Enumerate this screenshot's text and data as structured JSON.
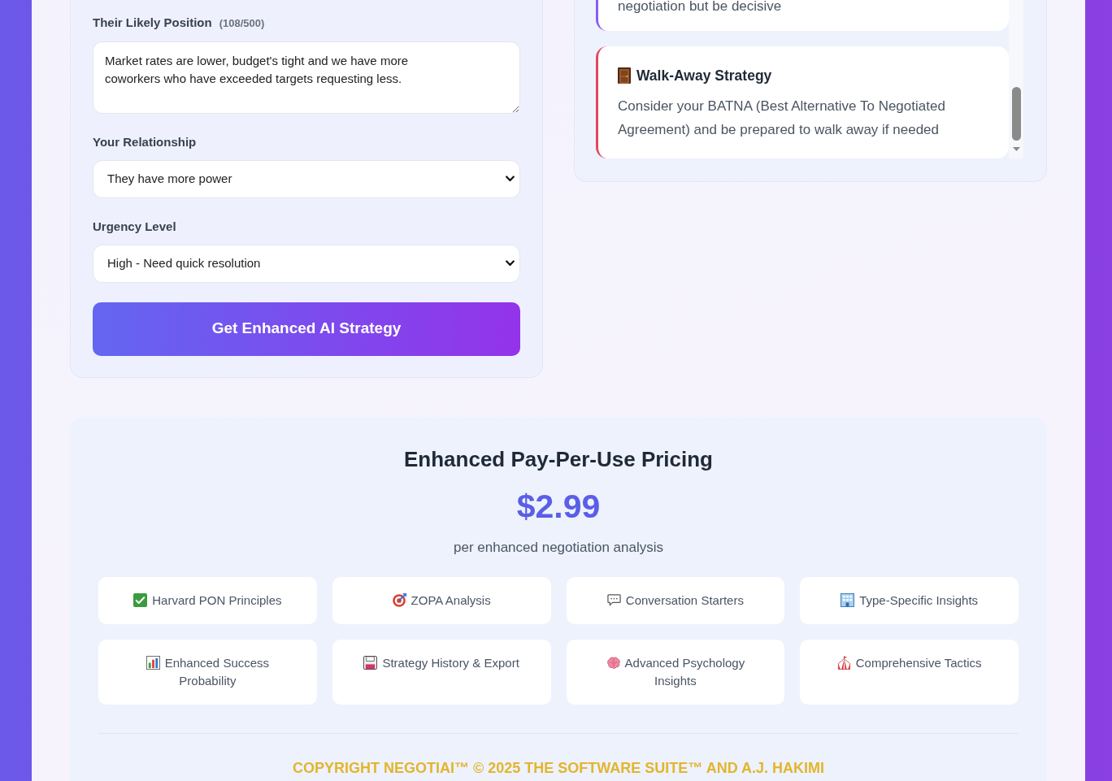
{
  "form": {
    "fields": [
      {
        "kind": "textarea",
        "label": "Their Likely Position",
        "counter": "(108/500)",
        "value": "Market rates are lower, budget's tight and we have more coworkers who have exceeded targets requesting less."
      },
      {
        "kind": "select",
        "label": "Your Relationship",
        "value": "They have more power"
      },
      {
        "kind": "select",
        "label": "Urgency Level",
        "value": "High - Need quick resolution"
      }
    ],
    "submit_button": "Get Enhanced AI Strategy"
  },
  "strategies": [
    {
      "text": "negotiation but be decisive",
      "color": "#8b5cf6"
    },
    {
      "title": "Walk-Away Strategy",
      "text": "Consider your BATNA (Best Alternative To Negotiated Agreement) and be prepared to walk away if needed",
      "color": "#e0485f"
    }
  ],
  "pricing": {
    "title": "Enhanced Pay-Per-Use Pricing",
    "price": "$2.99",
    "price_note": "per enhanced negotiation analysis",
    "features": [
      "Harvard PON Principles",
      "ZOPA Analysis",
      "Conversation Starters",
      "Type-Specific Insights",
      "Enhanced Success Probability",
      "Strategy History & Export",
      "Advanced Psychology Insights",
      "Comprehensive Tactics"
    ]
  },
  "footer": {
    "copyright": "COPYRIGHT NEGOTIAI™ © 2025 THE SOFTWARE SUITE™ AND A.J. HAKIMI"
  }
}
